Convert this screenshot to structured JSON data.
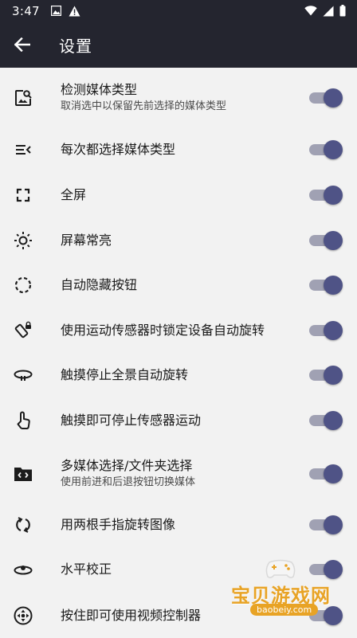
{
  "status_bar": {
    "time": "3:47",
    "left_icons": [
      "image-icon",
      "warning-icon"
    ],
    "right_icons": [
      "wifi-icon",
      "signal-icon",
      "battery-icon"
    ]
  },
  "app_bar": {
    "title": "设置",
    "back_icon": "arrow-back-icon"
  },
  "settings": [
    {
      "title": "检测媒体类型",
      "subtitle": "取消选中以保留先前选择的媒体类型",
      "icon": "image-search-icon",
      "enabled": true
    },
    {
      "title": "每次都选择媒体类型",
      "subtitle": "",
      "icon": "menu-open-icon",
      "enabled": true
    },
    {
      "title": "全屏",
      "subtitle": "",
      "icon": "fullscreen-icon",
      "enabled": true
    },
    {
      "title": "屏幕常亮",
      "subtitle": "",
      "icon": "brightness-icon",
      "enabled": true
    },
    {
      "title": "自动隐藏按钮",
      "subtitle": "",
      "icon": "dashed-circle-icon",
      "enabled": true
    },
    {
      "title": "使用运动传感器时锁定设备自动旋转",
      "subtitle": "",
      "icon": "screen-lock-rotation-icon",
      "enabled": true
    },
    {
      "title": "触摸停止全景自动旋转",
      "subtitle": "",
      "icon": "panorama-rotate-icon",
      "enabled": true
    },
    {
      "title": "触摸即可停止传感器运动",
      "subtitle": "",
      "icon": "touch-icon",
      "enabled": true
    },
    {
      "title": "多媒体选择/文件夹选择",
      "subtitle": "使用前进和后退按钮切换媒体",
      "icon": "folder-code-icon",
      "enabled": true
    },
    {
      "title": "用两根手指旋转图像",
      "subtitle": "",
      "icon": "rotate-icon",
      "enabled": true
    },
    {
      "title": "水平校正",
      "subtitle": "",
      "icon": "horizon-icon",
      "enabled": true
    },
    {
      "title": "按住即可使用视频控制器",
      "subtitle": "",
      "icon": "gamepad-circle-icon",
      "enabled": true
    }
  ],
  "watermark": {
    "text": "宝贝游戏网",
    "url": "baobeiy.com"
  }
}
